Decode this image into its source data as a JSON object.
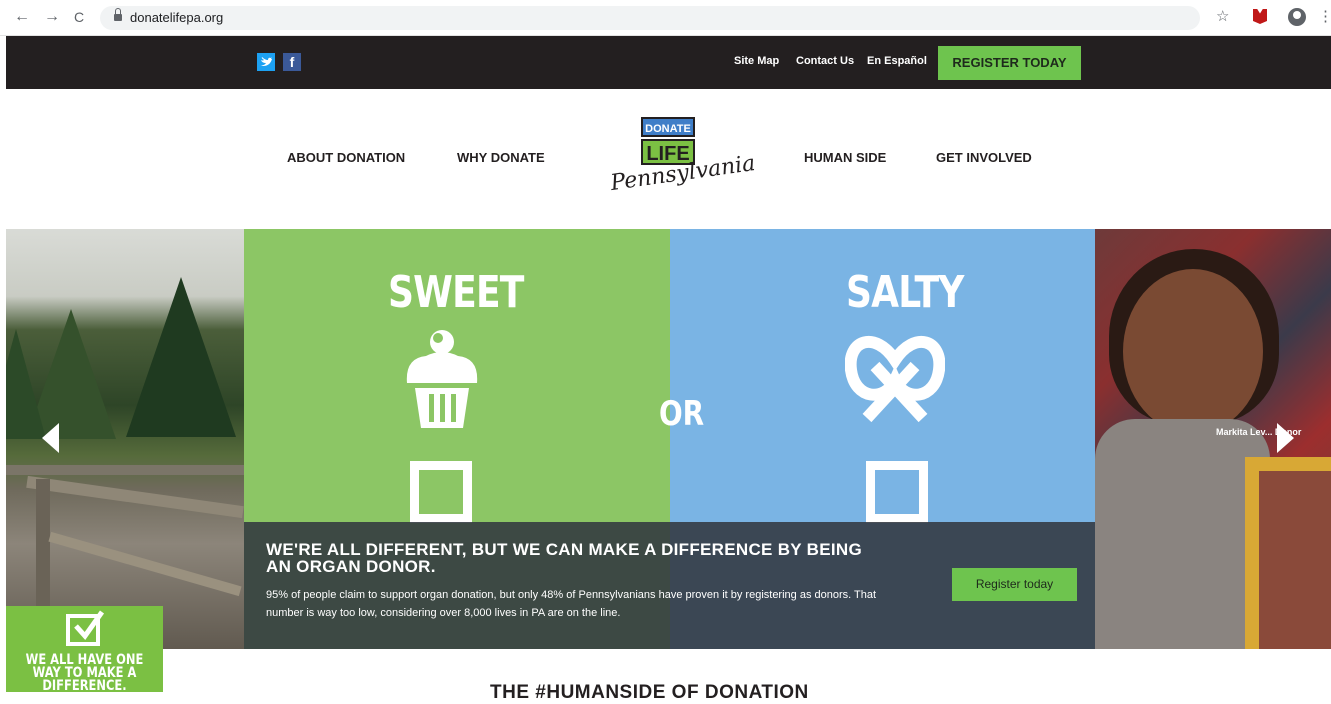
{
  "browser": {
    "url": "donatelifepa.org",
    "back_icon": "←",
    "forward_icon": "→",
    "reload_icon": "C",
    "star_icon": "☆",
    "menu_icon": "⋮"
  },
  "topbar": {
    "links": [
      "Site Map",
      "Contact Us",
      "En Español"
    ],
    "register_label": "REGISTER TODAY"
  },
  "nav": {
    "items": [
      "ABOUT DONATION",
      "WHY DONATE",
      "HUMAN SIDE",
      "GET INVOLVED"
    ]
  },
  "logo": {
    "donate": "DONATE",
    "life": "LIFE",
    "state": "Pennsylvania"
  },
  "hero": {
    "left_word": "SWEET",
    "right_word": "SALTY",
    "middle_word": "OR",
    "title": "WE'RE ALL DIFFERENT, BUT WE CAN MAKE A DIFFERENCE BY BEING AN ORGAN DONOR.",
    "body": "95% of people claim to support organ donation, but only 48% of Pennsylvanians have proven it by registering as donors. That number is way too low, considering over 8,000 lives in PA are on the line.",
    "button": "Register today",
    "photo_caption": "Markita Lev... Donor"
  },
  "badge": {
    "text": "WE ALL HAVE ONE WAY TO MAKE A DIFFERENCE."
  },
  "section": {
    "heading": "THE #HUMANSIDE OF DONATION"
  },
  "colors": {
    "green": "#8cc665",
    "blue": "#7ab4e4",
    "button_green": "#6ec44e",
    "dark": "#231f20"
  }
}
